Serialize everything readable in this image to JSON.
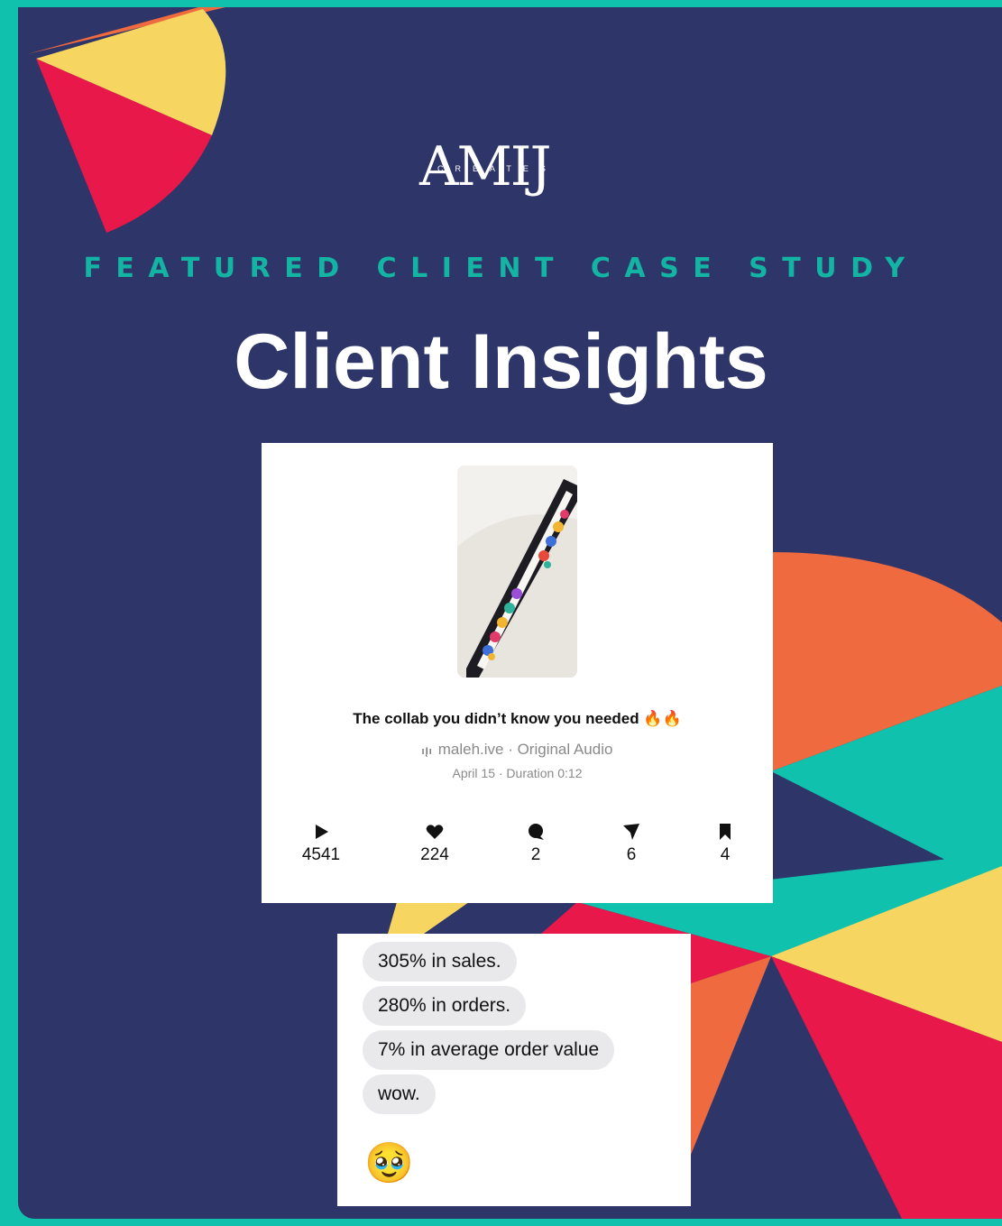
{
  "brand": {
    "logo_letters": "AMIJ",
    "logo_subtext": "CREATES"
  },
  "header": {
    "kicker": "FEATURED CLIENT CASE STUDY",
    "title": "Client Insights"
  },
  "colors": {
    "background": "#2e3568",
    "border_teal": "#10c2ad",
    "kicker_teal": "#14b4a4",
    "accent_red": "#e8194a",
    "accent_yellow": "#f6d560",
    "accent_orange": "#ef6a3f"
  },
  "post": {
    "caption": "The collab you didn’t know you needed 🔥🔥",
    "audio_icon": "audio-wave-icon",
    "audio": "maleh.ive · Original Audio",
    "date": "April 15 · Duration 0:12",
    "stats": [
      {
        "icon": "play-icon",
        "value": "4541"
      },
      {
        "icon": "heart-icon",
        "value": "224"
      },
      {
        "icon": "comment-icon",
        "value": "2"
      },
      {
        "icon": "share-icon",
        "value": "6"
      },
      {
        "icon": "bookmark-icon",
        "value": "4"
      }
    ]
  },
  "messages": [
    {
      "text": "305% in sales."
    },
    {
      "text": "280% in orders."
    },
    {
      "text": "7% in average order value"
    },
    {
      "text": "wow."
    },
    {
      "text": "🥹"
    }
  ]
}
